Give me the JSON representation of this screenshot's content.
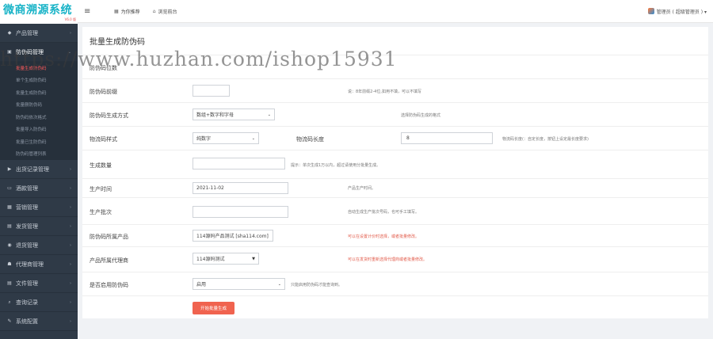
{
  "brand": {
    "title": "微商溯源系统",
    "version": "V6.0 版"
  },
  "topbar": {
    "menu_icon": "hamburger-icon",
    "links": [
      {
        "label": "为你推荐",
        "icon": "grid-icon"
      },
      {
        "label": "浏览前台",
        "icon": "home-icon"
      }
    ],
    "user": "管理员 ( 超级管理员 ) ▾"
  },
  "sidebar": {
    "items": [
      {
        "label": "产品管理",
        "icon": "tag-icon"
      },
      {
        "label": "防伪码管理",
        "icon": "shield-icon",
        "active": true
      },
      {
        "label": "出货记录管理",
        "icon": "truck-icon"
      },
      {
        "label": "酒款管理",
        "icon": "bottle-icon"
      },
      {
        "label": "营销管理",
        "icon": "grid-icon"
      },
      {
        "label": "发货管理",
        "icon": "send-icon"
      },
      {
        "label": "退货管理",
        "icon": "return-icon"
      },
      {
        "label": "代理商管理",
        "icon": "users-icon"
      },
      {
        "label": "文件管理",
        "icon": "file-icon"
      },
      {
        "label": "查询记录",
        "icon": "search-icon"
      },
      {
        "label": "系统配置",
        "icon": "wrench-icon"
      }
    ],
    "sub_items": [
      "批量生成防伪码",
      "单个生成防伪码",
      "批量生成防伪码",
      "批量删防伪码",
      "防伪码依次格式",
      "批量导入防伪码",
      "批量已生防伪码",
      "防伪码管理列表"
    ]
  },
  "main": {
    "title": "批量生成防伪码",
    "rows": [
      {
        "label": "防伪码位数",
        "value": "",
        "hint": ""
      },
      {
        "label": "防伪码前缀",
        "value": "",
        "hint": "说：8年前缀2-4位,如用不填，可以不填写"
      },
      {
        "label": "防伪码生成方式",
        "value": "数组+数字和字母",
        "hint": "选择防伪码生成的格式"
      },
      {
        "label": "物流码样式",
        "value": "纯数字",
        "hint": "物流码长度",
        "value2": "8",
        "hint2": "物流码长度(：自定长度，按钮上设定最长度要求)"
      },
      {
        "label": "生成数量",
        "value": "",
        "hint": "提示：单次生成1万以内，超过请使用分批量生成。"
      },
      {
        "label": "生产时间",
        "value": "2021-11-02",
        "hint": "产品生产时间。"
      },
      {
        "label": "生产批次",
        "value": "",
        "hint": "自动生成生产批次号码，也可手工填写。"
      },
      {
        "label": "防伪码所属产品",
        "value": "114源码产品测试 [sha114.com]",
        "hint": "可以在设置计价时选择，或者批量修改。"
      },
      {
        "label": "产品所属代理商",
        "value": "114源码测试",
        "hint": "可以在发货时重新选择代理商或者批量修改。"
      },
      {
        "label": "是否启用防伪码",
        "value": "启用",
        "hint": "只能启用防伪码才能查询到。"
      }
    ],
    "submit_label": "开始批量生成"
  },
  "watermark": "https://www.huzhan.com/ishop15931"
}
